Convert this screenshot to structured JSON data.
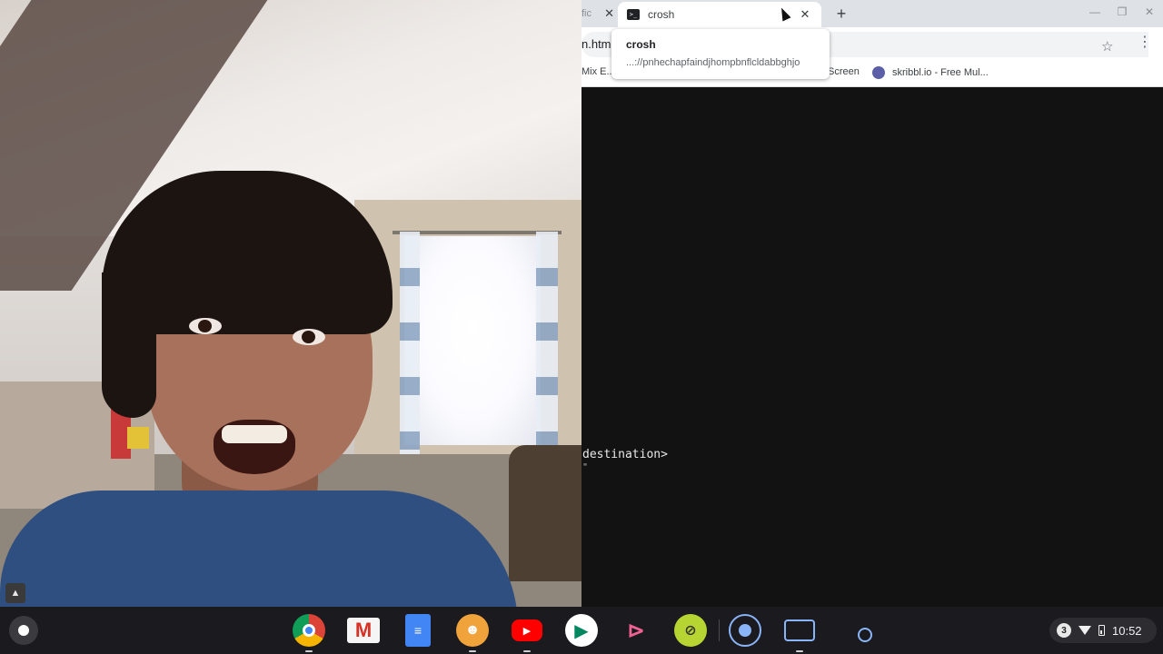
{
  "browser": {
    "partial_tab_label": "fic",
    "active_tab": {
      "title": "crosh",
      "icon": "terminal-icon"
    },
    "tooltip": {
      "title": "crosh",
      "url": "...://pnhechapfaindjhompbnflcldabbghjo"
    },
    "omnibox_text": "n.html",
    "bookmarks": [
      {
        "label": "Mix E..."
      },
      {
        "label": "Screen"
      },
      {
        "label": "skribbl.io - Free Mul...",
        "icon": "skribbl-icon"
      }
    ]
  },
  "terminal": {
    "lines": [
      "destination>",
      "\""
    ]
  },
  "shelf": {
    "apps": [
      {
        "name": "chrome",
        "running": true
      },
      {
        "name": "gmail",
        "running": false
      },
      {
        "name": "docs",
        "running": false
      },
      {
        "name": "game-robot",
        "running": true
      },
      {
        "name": "youtube",
        "running": true
      },
      {
        "name": "play-store",
        "running": false
      },
      {
        "name": "pink-app",
        "running": false
      },
      {
        "name": "tennis-ball-app",
        "running": false
      },
      {
        "name": "camera-dot-app",
        "running": false
      },
      {
        "name": "screen-capture",
        "running": true
      },
      {
        "name": "small-circle-app",
        "running": false
      }
    ],
    "status": {
      "notification_count": "3",
      "time": "10:52"
    }
  },
  "colors": {
    "shelf_bg": "#1b1a1f",
    "terminal_bg": "#121212",
    "tabstrip_bg": "#dee1e6"
  }
}
